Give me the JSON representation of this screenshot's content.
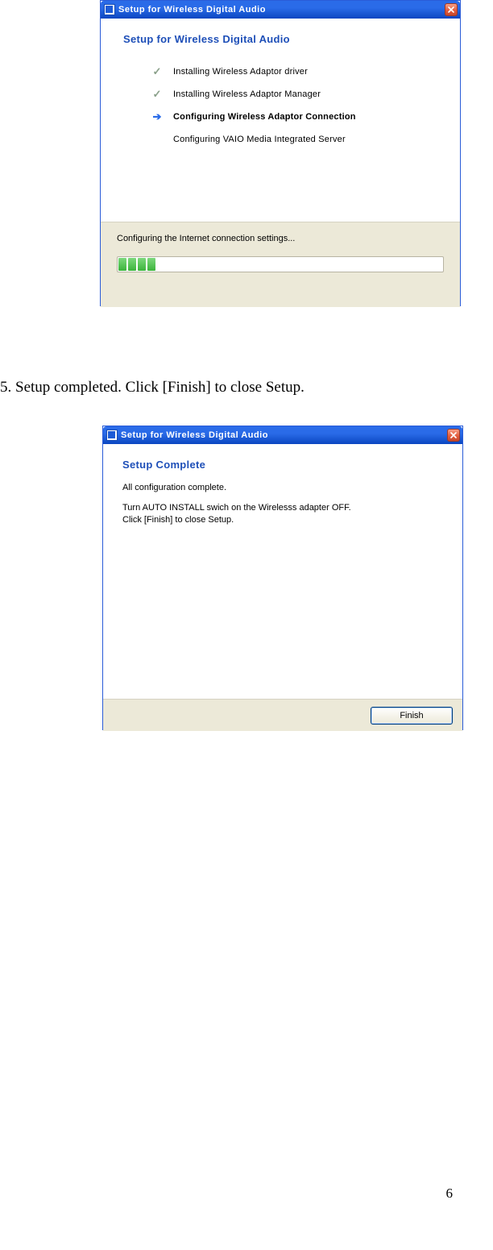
{
  "dialog1": {
    "window_title": "Setup for Wireless Digital Audio",
    "heading": "Setup for Wireless Digital Audio",
    "steps": [
      {
        "text": "Installing Wireless Adaptor driver",
        "state": "done"
      },
      {
        "text": "Installing Wireless Adaptor Manager",
        "state": "done"
      },
      {
        "text": "Configuring Wireless Adaptor Connection",
        "state": "current"
      },
      {
        "text": "Configuring VAIO Media Integrated Server",
        "state": "pending"
      }
    ],
    "status_text": "Configuring the Internet connection settings...",
    "progress_blocks_filled": 4
  },
  "instruction": "5. Setup completed. Click [Finish] to close Setup.",
  "dialog2": {
    "window_title": "Setup for Wireless Digital Audio",
    "heading": "Setup Complete",
    "line1": "All configuration complete.",
    "line2": "Turn AUTO INSTALL swich on the Wirelesss adapter OFF.",
    "line3": "Click [Finish] to close Setup.",
    "finish_label": "Finish"
  },
  "page_number": "6"
}
